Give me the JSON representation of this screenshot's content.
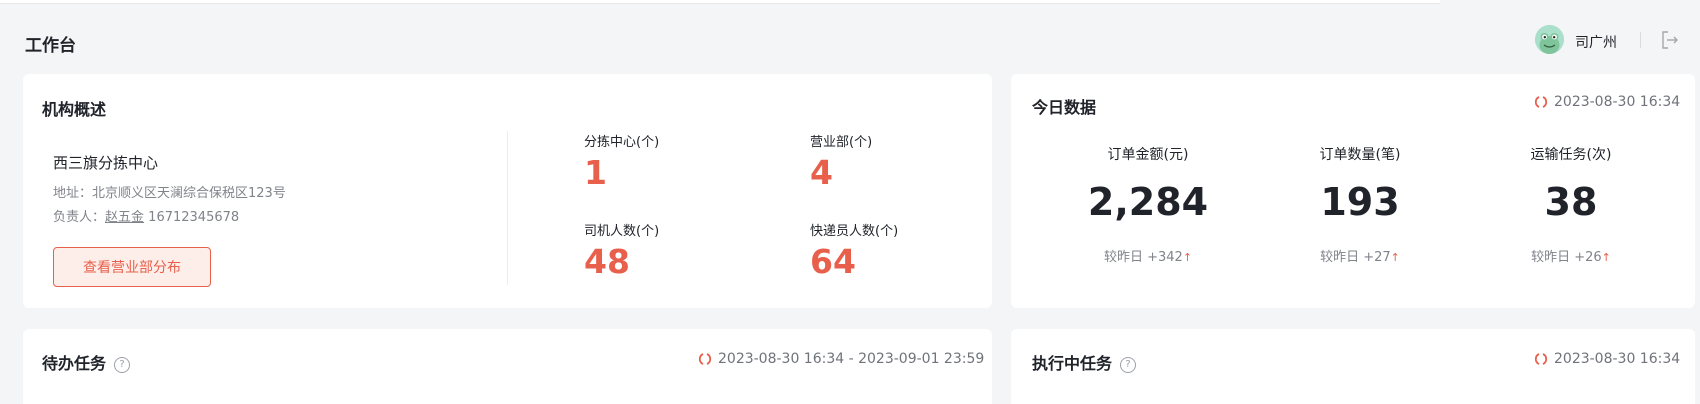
{
  "header": {
    "title": "工作台",
    "user_name": "司广州",
    "avatar_icon": "frog-avatar-icon",
    "logout_icon": "logout-icon"
  },
  "org_overview": {
    "title": "机构概述",
    "org_name": "西三旗分拣中心",
    "address_label": "地址：",
    "address": "北京顺义区天澜综合保税区123号",
    "manager_label": "负责人：",
    "manager_name": "赵五金",
    "manager_phone": "16712345678",
    "button_label": "查看营业部分布",
    "stats": [
      {
        "label": "分拣中心(个)",
        "value": "1"
      },
      {
        "label": "营业部(个)",
        "value": "4"
      },
      {
        "label": "司机人数(个)",
        "value": "48"
      },
      {
        "label": "快递员人数(个)",
        "value": "64"
      }
    ]
  },
  "today_data": {
    "title": "今日数据",
    "timestamp": "2023-08-30 16:34",
    "metrics": [
      {
        "label": "订单金额(元)",
        "value": "2,284",
        "compare": "较昨日 +342"
      },
      {
        "label": "订单数量(笔)",
        "value": "193",
        "compare": "较昨日 +27"
      },
      {
        "label": "运输任务(次)",
        "value": "38",
        "compare": "较昨日 +26"
      }
    ],
    "up_arrow": "↑"
  },
  "pending_tasks": {
    "title": "待办任务",
    "help": "?",
    "timestamp": "2023-08-30 16:34 - 2023-09-01 23:59"
  },
  "executing_tasks": {
    "title": "执行中任务",
    "help": "?",
    "timestamp": "2023-08-30 16:34"
  },
  "colors": {
    "accent": "#e8604c",
    "text": "#20232a",
    "muted": "#80838a",
    "background": "#f4f5f7"
  }
}
